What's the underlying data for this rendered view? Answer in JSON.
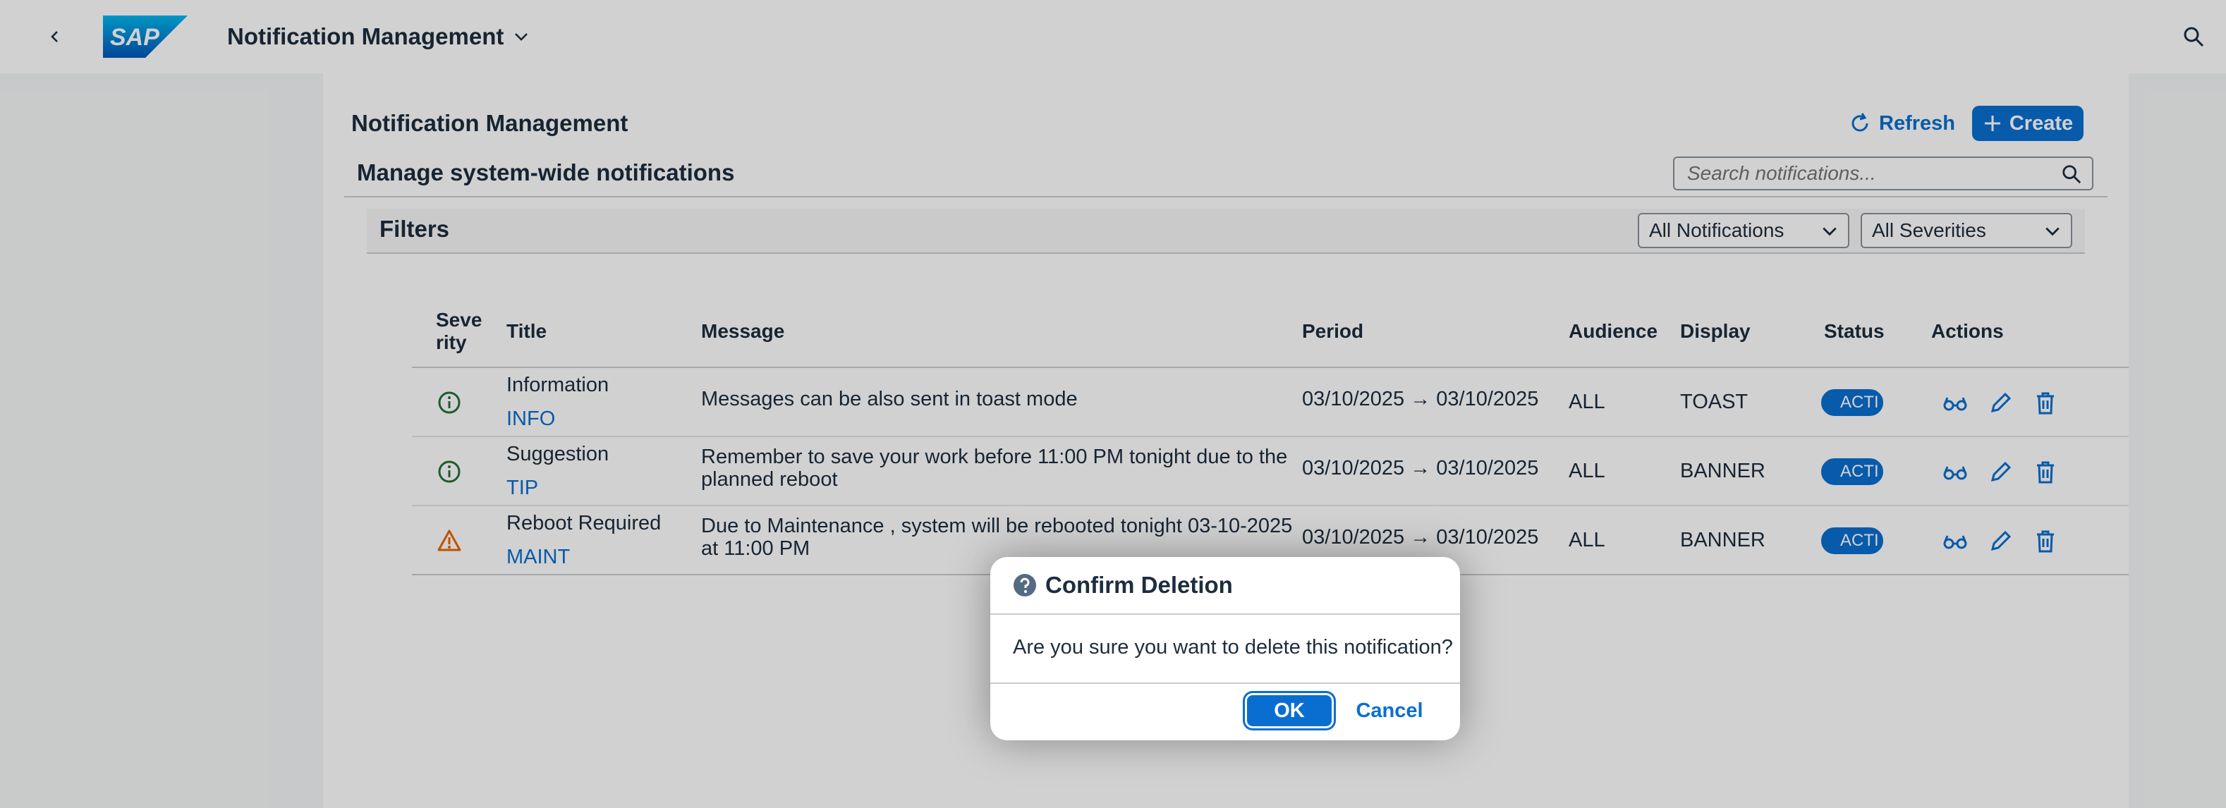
{
  "shell": {
    "app_title": "Notification Management",
    "logo_text": "SAP"
  },
  "page": {
    "title": "Notification Management",
    "subtitle": "Manage system-wide notifications",
    "refresh_label": "Refresh",
    "create_label": "Create",
    "search_placeholder": "Search notifications..."
  },
  "filters": {
    "label": "Filters",
    "type_select": "All Notifications",
    "severity_select": "All Severities"
  },
  "table": {
    "headers": {
      "severity_line1": "Seve",
      "severity_line2": "rity",
      "title": "Title",
      "message": "Message",
      "period": "Period",
      "audience": "Audience",
      "display": "Display",
      "status": "Status",
      "actions": "Actions"
    },
    "rows": [
      {
        "severity_icon": "info-icon",
        "title": "Information",
        "code": "INFO",
        "message_line1": "Messages can be also sent in toast mode",
        "message_line2": "",
        "period": "03/10/2025 → 03/10/2025",
        "audience": "ALL",
        "display": "TOAST",
        "status": "ACTI"
      },
      {
        "severity_icon": "info-icon",
        "title": "Suggestion",
        "code": "TIP",
        "message_line1": "Remember to save your work before 11:00 PM tonight due to the",
        "message_line2": "planned reboot",
        "period": "03/10/2025 → 03/10/2025",
        "audience": "ALL",
        "display": "BANNER",
        "status": "ACTI"
      },
      {
        "severity_icon": "warning-icon",
        "title": "Reboot Required",
        "code": "MAINT",
        "message_line1": "Due to Maintenance , system will be rebooted tonight 03-10-2025",
        "message_line2": "at 11:00 PM",
        "period": "03/10/2025 → 03/10/2025",
        "audience": "ALL",
        "display": "BANNER",
        "status": "ACTI"
      }
    ]
  },
  "dialog": {
    "title": "Confirm Deletion",
    "message": "Are you sure you want to delete this notification?",
    "ok_label": "OK",
    "cancel_label": "Cancel"
  },
  "colors": {
    "accent": "#0a6ed1",
    "info": "#256f3a",
    "warning": "#e76500",
    "text": "#1d2d3e"
  }
}
